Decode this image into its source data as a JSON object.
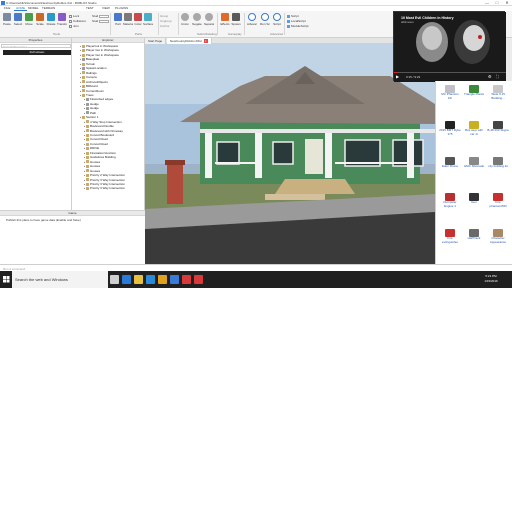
{
  "window": {
    "title": "C:\\Users\\ublic\\Documents\\NewCountyRoblox.rbxl - ROBLOX Studio",
    "minimize": "—",
    "maximize": "□",
    "close": "✕"
  },
  "menu": {
    "items": [
      "FILE",
      "HOME",
      "MODEL",
      "TERRAIN",
      "TEST",
      "VIEW",
      "PLUGINS"
    ],
    "active": "HOME"
  },
  "ribbon": {
    "tools": [
      {
        "label": "Paste",
        "icon": "paste-icon",
        "color": "#7a8aa0"
      },
      {
        "label": "Select",
        "icon": "select-icon",
        "color": "#4a7ac8"
      },
      {
        "label": "Move",
        "icon": "move-icon",
        "color": "#4aa04a"
      },
      {
        "label": "Scale",
        "icon": "scale-icon",
        "color": "#c86a2a"
      },
      {
        "label": "Rotate",
        "icon": "rotate-icon",
        "color": "#2a9ac8"
      },
      {
        "label": "Transform",
        "icon": "transform-icon",
        "color": "#8a5ac8"
      }
    ],
    "checks": [
      "Lock",
      "Collisions",
      "Join"
    ],
    "fields": [
      {
        "label": "Stud",
        "value": ""
      },
      {
        "label": "Stud",
        "value": ""
      }
    ],
    "parts": [
      {
        "label": "Part",
        "icon": "part-icon",
        "color": "#4a78c8"
      },
      {
        "label": "Material",
        "icon": "material-icon",
        "color": "#7a7a7a"
      },
      {
        "label": "Color",
        "icon": "color-icon",
        "color": "#c84a4a"
      },
      {
        "label": "Surface",
        "icon": "surface-icon",
        "color": "#4ab0c8"
      }
    ],
    "group_tools": [
      "Group",
      "Ungroup",
      "Anchor"
    ],
    "solid_model": [
      {
        "label": "Union",
        "icon": "union-icon"
      },
      {
        "label": "Negate",
        "icon": "negate-icon"
      },
      {
        "label": "Separate",
        "icon": "separate-icon"
      }
    ],
    "gameplay": [
      {
        "label": "Effects",
        "icon": "effects-icon",
        "color": "#e06a2a"
      },
      {
        "label": "Spawn",
        "icon": "spawn-icon",
        "color": "#5a5a5a"
      }
    ],
    "advanced": [
      {
        "label": "Advanced Objects",
        "icon": "advanced-objects-icon"
      },
      {
        "label": "Run Script",
        "icon": "run-script-icon"
      },
      {
        "label": "Script",
        "icon": "script-icon"
      }
    ],
    "scripts": [
      "Script",
      "LocalScript",
      "ModuleScript"
    ],
    "sections": [
      "Tools",
      "Parts",
      "Solid Modeling",
      "Gameplay",
      "Advanced"
    ]
  },
  "properties": {
    "header": "Properties",
    "filter_placeholder": "Search Properties",
    "toolbar_label": "Full screen"
  },
  "explorer": {
    "header": "Explorer",
    "rows": [
      {
        "label": "PlayerGui in Workspace",
        "depth": 1,
        "kind": "model"
      },
      {
        "label": "Player Gui in Workspace",
        "depth": 1,
        "kind": "model"
      },
      {
        "label": "Player Gui in Workspace",
        "depth": 1,
        "kind": "model"
      },
      {
        "label": "Baseplate",
        "depth": 1,
        "kind": "part"
      },
      {
        "label": "Terrain",
        "depth": 1,
        "kind": "model"
      },
      {
        "label": "SpawnLocation",
        "depth": 1,
        "kind": "part"
      },
      {
        "label": "Railings",
        "depth": 1,
        "kind": "model"
      },
      {
        "label": "Camera",
        "depth": 1,
        "kind": "model"
      },
      {
        "label": "ArchivedObjects",
        "depth": 1,
        "kind": "model"
      },
      {
        "label": "Billboard",
        "depth": 1,
        "kind": "model"
      },
      {
        "label": "CurrentRoom",
        "depth": 1,
        "kind": "model"
      },
      {
        "label": "Trees",
        "depth": 1,
        "kind": "model"
      },
      {
        "label": "Flowerbed edges",
        "depth": 2,
        "kind": "part"
      },
      {
        "label": "Hedge",
        "depth": 2,
        "kind": "part"
      },
      {
        "label": "Hedge",
        "depth": 2,
        "kind": "part"
      },
      {
        "label": "Path",
        "depth": 2,
        "kind": "part"
      },
      {
        "label": "Section 1",
        "depth": 1,
        "kind": "model"
      },
      {
        "label": "4 Way Stop Intersection",
        "depth": 2,
        "kind": "model"
      },
      {
        "label": "Boulevard Double",
        "depth": 2,
        "kind": "model"
      },
      {
        "label": "Boulevard with Driveway",
        "depth": 2,
        "kind": "model"
      },
      {
        "label": "Curved Boulevard",
        "depth": 2,
        "kind": "model"
      },
      {
        "label": "Curved Road",
        "depth": 2,
        "kind": "model"
      },
      {
        "label": "Curved Road",
        "depth": 2,
        "kind": "model"
      },
      {
        "label": "DRIVE",
        "depth": 2,
        "kind": "model"
      },
      {
        "label": "Firestation/Junction",
        "depth": 2,
        "kind": "model"
      },
      {
        "label": "Guidelines Building",
        "depth": 2,
        "kind": "model"
      },
      {
        "label": "Houses",
        "depth": 2,
        "kind": "model"
      },
      {
        "label": "Houses",
        "depth": 2,
        "kind": "model"
      },
      {
        "label": "Houses",
        "depth": 2,
        "kind": "model"
      },
      {
        "label": "Priority 2 Way Intersection",
        "depth": 2,
        "kind": "model"
      },
      {
        "label": "Priority 3 Way Intersection",
        "depth": 2,
        "kind": "model"
      },
      {
        "label": "Priority 3 Way Intersection",
        "depth": 2,
        "kind": "model"
      },
      {
        "label": "Priority 3 Way Intersection",
        "depth": 2,
        "kind": "model"
      }
    ]
  },
  "output": {
    "header": "Game",
    "line": "Publish this place to have game data (Enable and Save)"
  },
  "doc_tabs": [
    {
      "label": "Start Page",
      "active": false,
      "closable": false
    },
    {
      "label": "NewCountyRoblox.Rbxl",
      "active": true,
      "closable": true
    }
  ],
  "video": {
    "title": "10 Most Evil Children in History",
    "channel": "alltimeten",
    "time": "0:15 / 9:23",
    "progress": 0.03
  },
  "toolbox": {
    "items": [
      {
        "name": "MC Phantom 16r",
        "color": "#c0c0c8"
      },
      {
        "name": "Triangle Plants",
        "color": "#3a8a3a"
      },
      {
        "name": "Taste 9 15 Building...",
        "color": "#c8c8c8"
      },
      {
        "name": "2015 BMT Ryke 175",
        "color": "#222222"
      },
      {
        "name": "Bus stop with car 1t",
        "color": "#c8b020"
      },
      {
        "name": "B-48 200 Skypa",
        "color": "#444444"
      },
      {
        "name": "Eden Drone",
        "color": "#555555"
      },
      {
        "name": "GMC Silverado",
        "color": "#888888"
      },
      {
        "name": "city building kit",
        "color": "#777777"
      },
      {
        "name": "Dumpster Engine 1",
        "color": "#b83030"
      },
      {
        "name": "Gun",
        "color": "#333333"
      },
      {
        "name": "Fire phantomWM",
        "color": "#c83030"
      },
      {
        "name": "Fire extinguisher",
        "color": "#c83030"
      },
      {
        "name": "HalfTrack",
        "color": "#6a6a6a"
      },
      {
        "name": "Character Appearance",
        "color": "#aa8866"
      }
    ]
  },
  "command_bar": {
    "placeholder": "Run a command"
  },
  "taskbar": {
    "search_placeholder": "Search the web and Windows",
    "time": "5:21 PM",
    "date": "1/15/2016",
    "apps": [
      {
        "icon": "task-view-icon",
        "color": "#cfcfcf"
      },
      {
        "icon": "edge-icon",
        "color": "#2a7ad8"
      },
      {
        "icon": "file-explorer-icon",
        "color": "#e8c040"
      },
      {
        "icon": "store-icon",
        "color": "#2a8ad8"
      },
      {
        "icon": "chrome-icon",
        "color": "#e0a020"
      },
      {
        "icon": "mail-icon",
        "color": "#3a7ad8"
      },
      {
        "icon": "app-icon",
        "color": "#d83a3a"
      },
      {
        "icon": "roblox-icon",
        "color": "#d83a3a"
      }
    ]
  }
}
